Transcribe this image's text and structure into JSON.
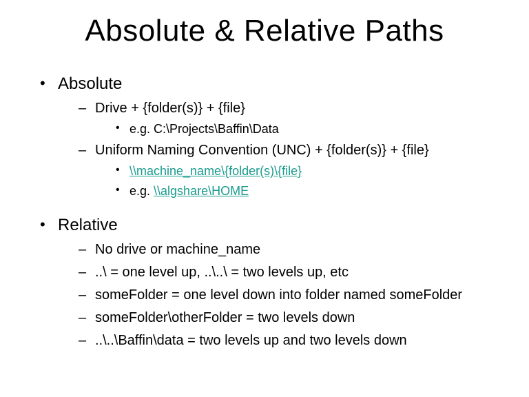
{
  "title": "Absolute &  Relative Paths",
  "sections": [
    {
      "heading": "Absolute",
      "items": [
        {
          "text": "Drive + {folder(s)} + {file}",
          "sub": [
            {
              "text": "e.g. C:\\Projects\\Baffin\\Data",
              "link": false
            }
          ]
        },
        {
          "text": "Uniform Naming Convention (UNC) + {folder(s)} + {file}",
          "sub": [
            {
              "text": "\\\\machine_name\\{folder(s)\\{file}",
              "link": true
            },
            {
              "prefix": "e.g. ",
              "text": "\\\\algshare\\HOME",
              "link": true
            }
          ]
        }
      ]
    },
    {
      "heading": "Relative",
      "items": [
        {
          "text": "No drive or machine_name"
        },
        {
          "text": "..\\ = one level up, ..\\..\\ = two levels up, etc"
        },
        {
          "text": "someFolder = one level down into folder named someFolder"
        },
        {
          "text": "someFolder\\otherFolder = two levels down"
        },
        {
          "text": "..\\..\\Baffin\\data = two levels up and two levels down"
        }
      ]
    }
  ]
}
